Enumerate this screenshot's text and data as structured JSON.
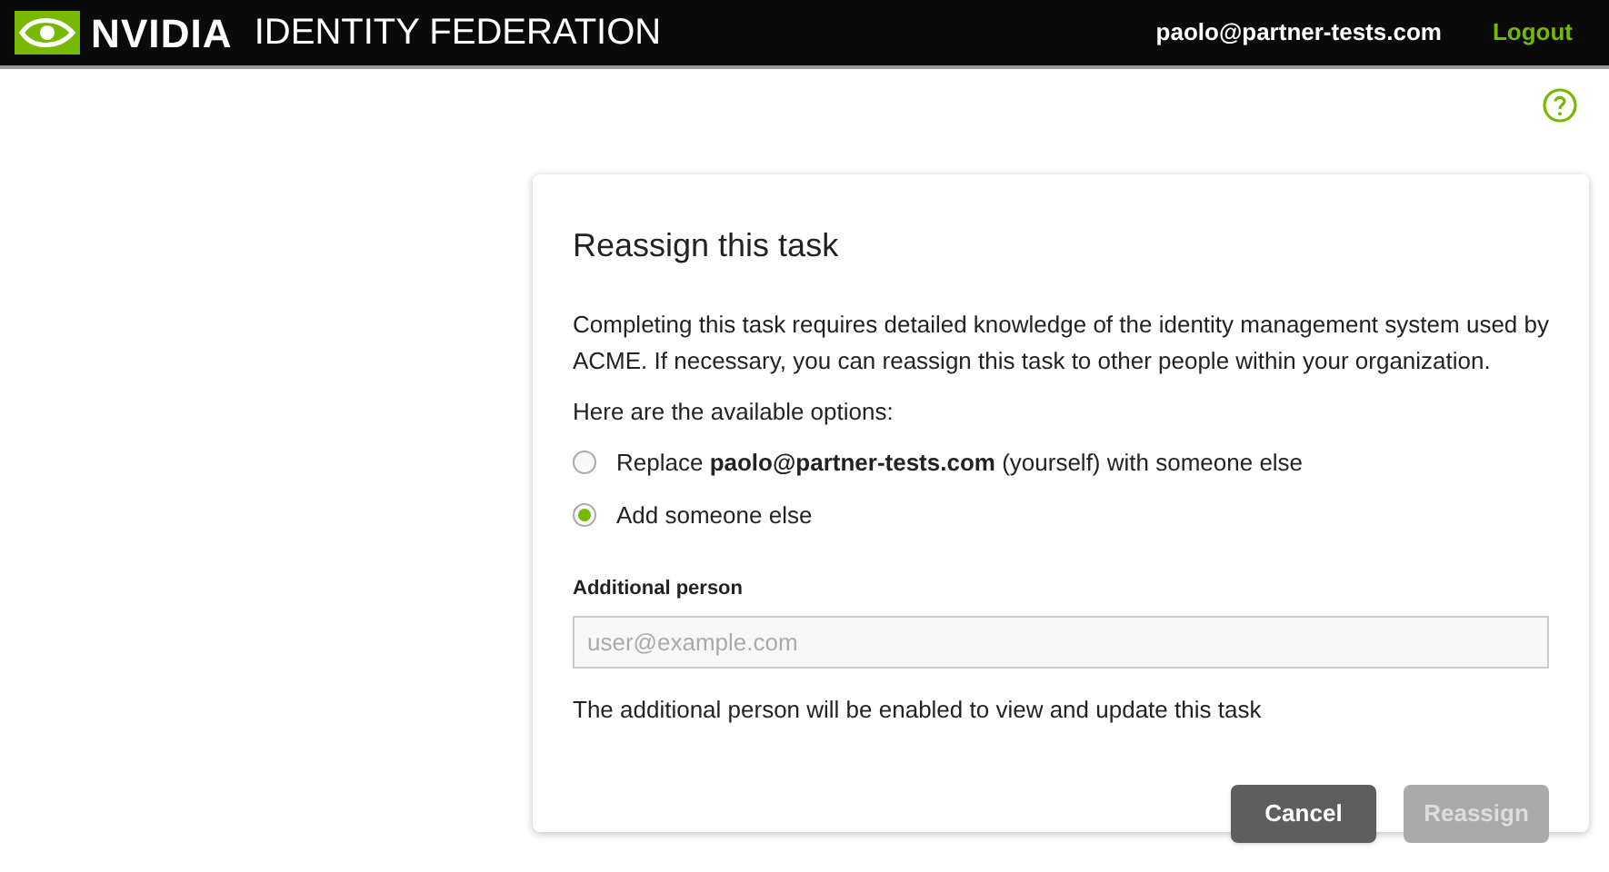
{
  "header": {
    "brand": "NVIDIA",
    "app_title": "IDENTITY FEDERATION",
    "user": "paolo@partner-tests.com",
    "logout": "Logout"
  },
  "dialog": {
    "title": "Reassign this task",
    "description": "Completing this task requires detailed knowledge of the identity management system used by ACME. If necessary, you can reassign this task to other people within your organization.",
    "options_label": "Here are the available options:",
    "options": [
      {
        "label": "Replace **paolo@partner-tests.com** (yourself) with someone else",
        "selected": false
      },
      {
        "label": "Add someone else",
        "selected": true
      }
    ],
    "field": {
      "label": "Additional person",
      "placeholder": "user@example.com"
    },
    "hint": "The additional person will be enabled to view and update this task",
    "buttons": [
      {
        "label": "Cancel",
        "disabled": false
      },
      {
        "label": "Reassign",
        "disabled": true
      }
    ]
  }
}
